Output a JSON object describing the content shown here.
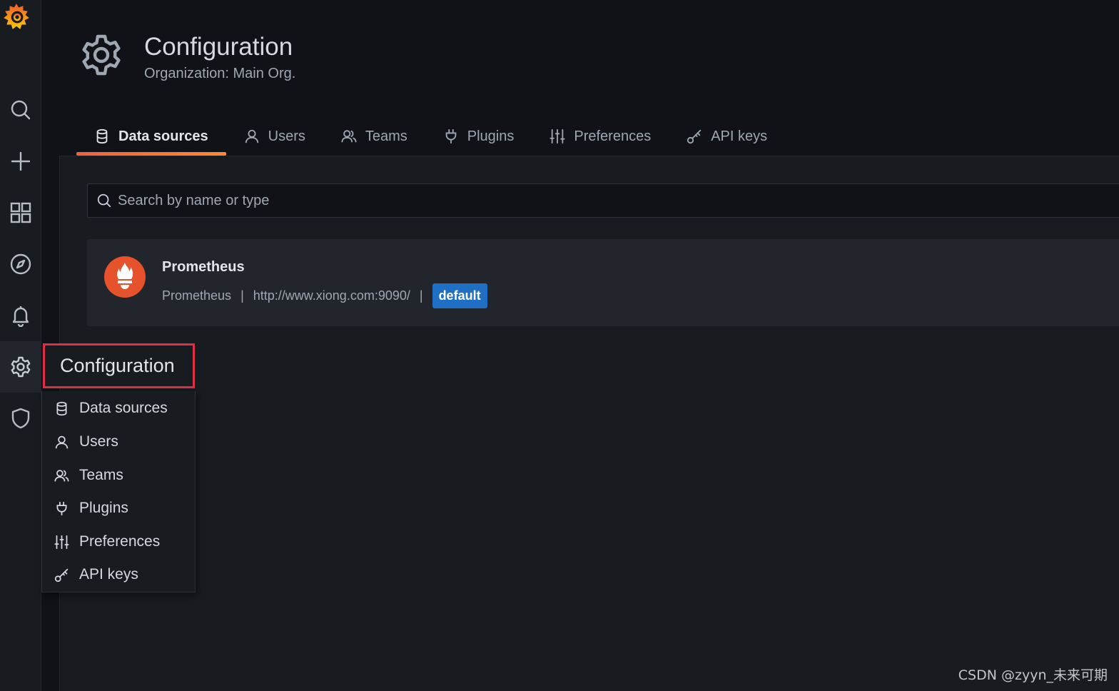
{
  "sidebar": {
    "logo": "grafana-logo",
    "items": [
      {
        "name": "search",
        "icon": "search-icon"
      },
      {
        "name": "create",
        "icon": "plus-icon"
      },
      {
        "name": "dashboards",
        "icon": "apps-icon"
      },
      {
        "name": "explore",
        "icon": "compass-icon"
      },
      {
        "name": "alerting",
        "icon": "bell-icon"
      },
      {
        "name": "configuration",
        "icon": "gear-icon",
        "active": true
      },
      {
        "name": "server-admin",
        "icon": "shield-icon"
      }
    ]
  },
  "header": {
    "title": "Configuration",
    "subtitle": "Organization: Main Org."
  },
  "tabs": [
    {
      "label": "Data sources",
      "icon": "database-icon",
      "active": true
    },
    {
      "label": "Users",
      "icon": "user-icon"
    },
    {
      "label": "Teams",
      "icon": "users-icon"
    },
    {
      "label": "Plugins",
      "icon": "plug-icon"
    },
    {
      "label": "Preferences",
      "icon": "sliders-icon"
    },
    {
      "label": "API keys",
      "icon": "key-icon"
    }
  ],
  "search": {
    "placeholder": "Search by name or type",
    "value": ""
  },
  "datasources": [
    {
      "name": "Prometheus",
      "type": "Prometheus",
      "url": "http://www.xiong.com:9090/",
      "separator": "|",
      "badge": "default",
      "logo": "prometheus-logo"
    }
  ],
  "flyout": {
    "title": "Configuration",
    "items": [
      {
        "label": "Data sources",
        "icon": "database-icon"
      },
      {
        "label": "Users",
        "icon": "user-icon"
      },
      {
        "label": "Teams",
        "icon": "users-icon"
      },
      {
        "label": "Plugins",
        "icon": "plug-icon"
      },
      {
        "label": "Preferences",
        "icon": "sliders-icon"
      },
      {
        "label": "API keys",
        "icon": "key-icon"
      }
    ]
  },
  "watermark": "CSDN @zyyn_未来可期",
  "colors": {
    "accent": "#f55f3e",
    "badge": "#1f6fc5",
    "highlight_box": "#e02f44",
    "prometheus": "#e6522c"
  }
}
